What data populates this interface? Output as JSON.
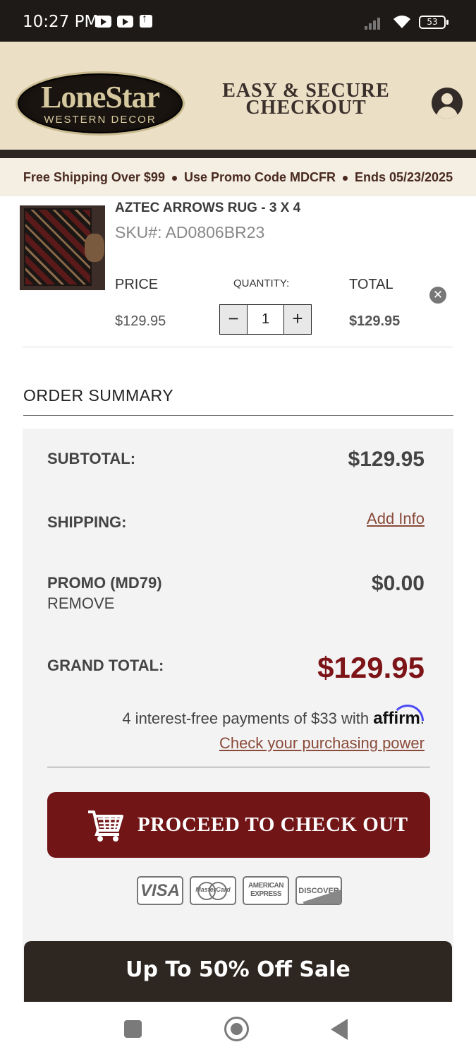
{
  "status_bar": {
    "time": "10:27 PM",
    "battery": "53"
  },
  "header": {
    "logo_line1": "LoneStar",
    "logo_line2": "WESTERN DECOR",
    "title_line1": "EASY & SECURE",
    "title_line2": "CHECKOUT"
  },
  "promo_bar": {
    "part1": "Free Shipping Over $99",
    "part2": "Use Promo Code MDCFR",
    "part3": "Ends 05/23/2025"
  },
  "cart_item": {
    "name": "AZTEC ARROWS RUG - 3 X 4",
    "sku": "SKU#: AD0806BR23",
    "price_label": "PRICE",
    "quantity_label": "QUANTITY:",
    "total_label": "TOTAL",
    "price": "$129.95",
    "quantity": "1",
    "total": "$129.95",
    "decrement": "−",
    "increment": "+",
    "remove": "✕"
  },
  "summary": {
    "title": "ORDER SUMMARY",
    "subtotal_label": "SUBTOTAL:",
    "subtotal_value": "$129.95",
    "shipping_label": "SHIPPING:",
    "shipping_link": "Add Info",
    "promo_label": "PROMO (MD79)",
    "promo_remove": "REMOVE",
    "promo_value": "$0.00",
    "grand_label": "GRAND TOTAL:",
    "grand_value": "$129.95",
    "affirm_text": "4 interest-free payments of $33 with ",
    "affirm_brand": "affirm",
    "affirm_period": ".",
    "power_link": "Check your purchasing power",
    "checkout_button": "PROCEED TO CHECK OUT",
    "cards": {
      "visa": "VISA",
      "mastercard": "MasterCard",
      "amex_1": "AMERICAN",
      "amex_2": "EXPRESS",
      "discover": "DISCOVER"
    }
  },
  "sale_banner": "Up To 50% Off Sale"
}
